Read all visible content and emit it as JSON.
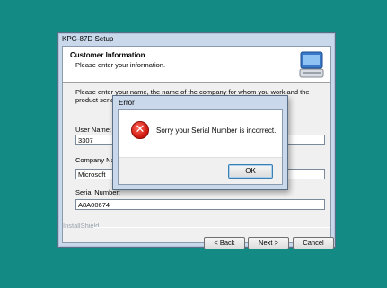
{
  "setup_window": {
    "title": "KPG-87D Setup",
    "header": {
      "title": "Customer Information",
      "subtitle": "Please enter your information."
    },
    "intro": "Please enter your name, the name of the company for whom you work and the product serial number.",
    "fields": [
      {
        "label": "User Name:",
        "value": "3307"
      },
      {
        "label": "Company Name:",
        "value": "Microsoft"
      },
      {
        "label": "Serial Number:",
        "value": "A8A00674"
      }
    ],
    "brand": "InstallShield",
    "buttons": {
      "back": "< Back",
      "next": "Next >",
      "cancel": "Cancel"
    }
  },
  "error_dialog": {
    "title": "Error",
    "icon": "error-x-icon",
    "message": "Sorry your Serial Number is incorrect.",
    "ok": "OK"
  },
  "colors": {
    "desktop": "#148a85",
    "error_red": "#d01a10"
  }
}
